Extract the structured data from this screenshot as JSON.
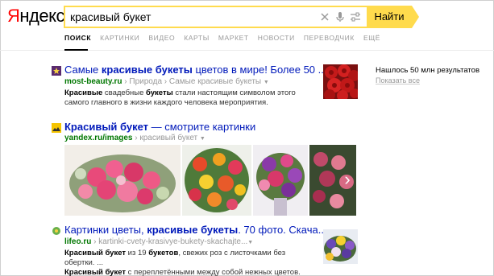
{
  "logo": {
    "part1": "Я",
    "part2": "ндекс"
  },
  "search": {
    "query": "красивый букет",
    "button_label": "Найти"
  },
  "tabs": [
    {
      "label": "ПОИСК"
    },
    {
      "label": "КАРТИНКИ"
    },
    {
      "label": "ВИДЕО"
    },
    {
      "label": "КАРТЫ"
    },
    {
      "label": "МАРКЕТ"
    },
    {
      "label": "НОВОСТИ"
    },
    {
      "label": "ПЕРЕВОДЧИК"
    },
    {
      "label": "ЕЩЁ"
    }
  ],
  "sidebar": {
    "found": "Нашлось 50 млн результатов",
    "show_all": "Показать все"
  },
  "results": [
    {
      "title_pre": "Самые ",
      "title_bold": "красивые букеты",
      "title_post": " цветов в мире! Более 50 ...",
      "host": "most-beauty.ru",
      "path": " › Природа › Самые красивые букеты ",
      "snippet_b1": "Красивые",
      "snippet_t1": " свадебные ",
      "snippet_b2": "букеты",
      "snippet_t2": " стали настоящим символом этого самого главного в жизни каждого человека мероприятия."
    },
    {
      "title_pre": "Красивый букет",
      "title_post": " — смотрите картинки",
      "host": "yandex.ru/images",
      "path": " › красивый букет "
    },
    {
      "title_pre": "Картинки цветы, ",
      "title_bold": "красивые букеты",
      "title_post": ". 70 фото. Скача...",
      "host": "lifeo.ru",
      "path": " › kartinki-cvety-krasivye-bukety-skachajte...",
      "snippet_b1": "Красивый букет",
      "snippet_t1": " из 19 ",
      "snippet_b2": "букетов",
      "snippet_t2": ", свежих роз с листочками без обертки. ...",
      "snippet_b3": "Красивый букет",
      "snippet_t3": " с переплетёнными между собой нежных цветов."
    }
  ],
  "icons": {
    "clear": "clear-icon",
    "mic": "microphone-icon",
    "settings": "settings-icon",
    "next": "chevron-right-icon"
  },
  "colors": {
    "accent": "#ffdb4d",
    "link": "#0019ba",
    "host": "#007700",
    "logo_red": "#ff0000"
  }
}
